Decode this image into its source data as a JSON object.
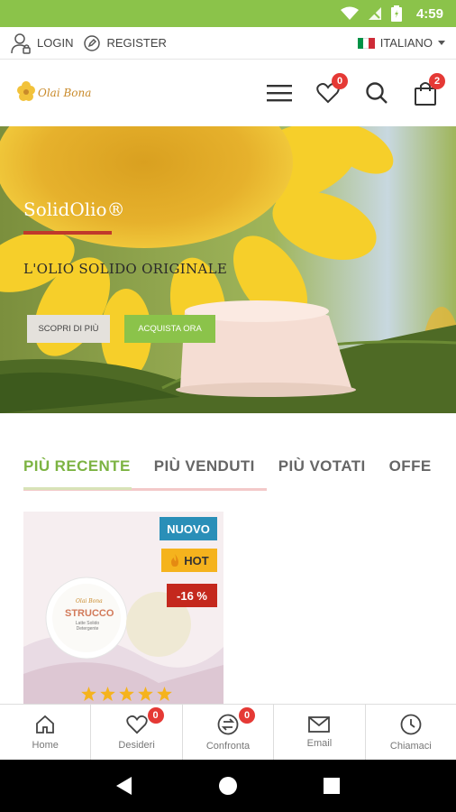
{
  "status_bar": {
    "time": "4:59"
  },
  "account_bar": {
    "login_label": "LOGIN",
    "register_label": "REGISTER",
    "language_label": "ITALIANO"
  },
  "header": {
    "logo_text": "Olai Bona",
    "wishlist_count": "0",
    "cart_count": "2"
  },
  "hero": {
    "title": "SolidOlio®",
    "subtitle": "L'OLIO SOLIDO ORIGINALE",
    "primary_button": "SCOPRI DI PIÙ",
    "secondary_button": "ACQUISTA ORA"
  },
  "tabs": [
    {
      "label": "PIÙ RECENTE"
    },
    {
      "label": "PIÙ VENDUTI"
    },
    {
      "label": "PIÙ VOTATI"
    },
    {
      "label": "OFFE"
    }
  ],
  "product": {
    "badge_new": "NUOVO",
    "badge_hot": "HOT",
    "badge_discount": "-16 %",
    "product_brand": "Olai Bona",
    "product_name": "STRUCCO",
    "product_desc": "Latte Solido Detergente",
    "rating": 5
  },
  "bottom_nav": [
    {
      "label": "Home"
    },
    {
      "label": "Desideri",
      "count": "0"
    },
    {
      "label": "Confronta",
      "count": "0"
    },
    {
      "label": "Email"
    },
    {
      "label": "Chiamaci"
    }
  ],
  "colors": {
    "brand_green": "#8bc34a",
    "badge_red": "#e53935",
    "label_blue": "#2a8fb8",
    "label_yellow": "#f5b31d",
    "label_red": "#c4281d"
  }
}
